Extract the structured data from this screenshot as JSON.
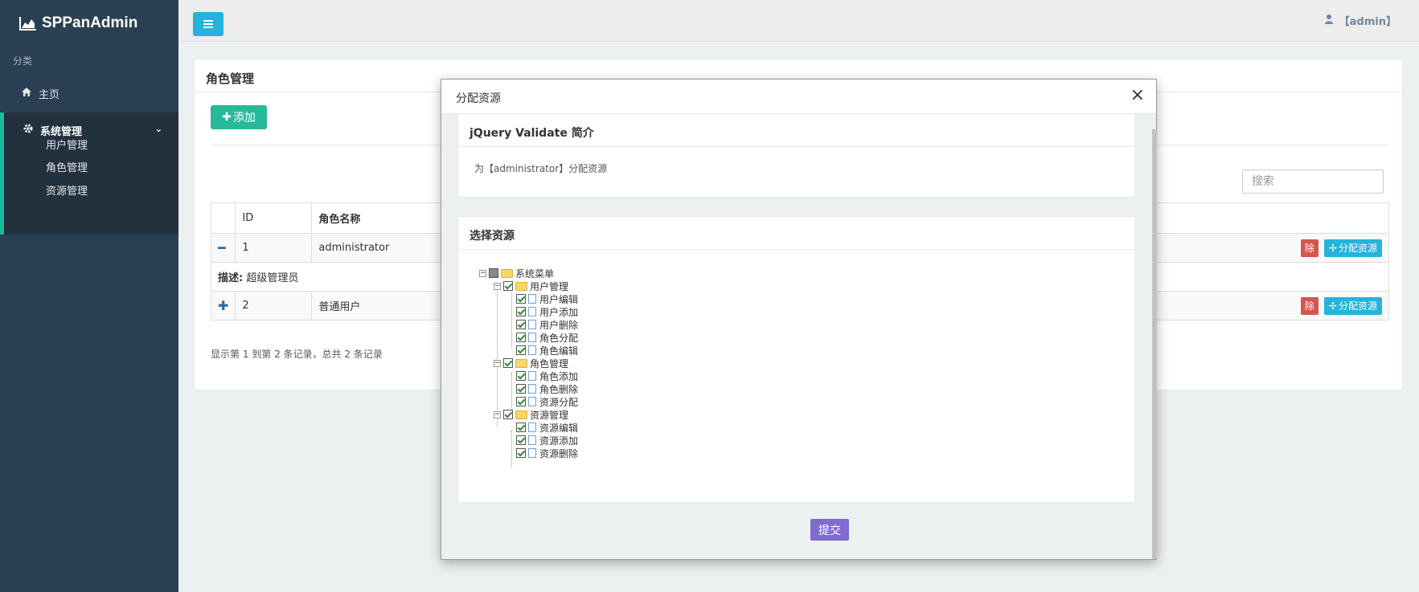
{
  "app": {
    "title": "SPPanAdmin"
  },
  "sidebar": {
    "section_label": "分类",
    "home_label": "主页",
    "group_label": "系统管理",
    "sub_items": [
      {
        "label": "用户管理"
      },
      {
        "label": "角色管理"
      },
      {
        "label": "资源管理"
      }
    ]
  },
  "topbar": {
    "user_label": "【admin】"
  },
  "panel": {
    "title": "角色管理",
    "add_label": "添加",
    "search_placeholder": "搜索",
    "columns": {
      "id": "ID",
      "name": "角色名称"
    },
    "rows": [
      {
        "id": "1",
        "name": "administrator",
        "detail_key": "描述:",
        "detail_value": "超级管理员",
        "delete_label": "除",
        "assign_label": "分配资源"
      },
      {
        "id": "2",
        "name": "普通用户",
        "delete_label": "除",
        "assign_label": "分配资源"
      }
    ],
    "footer": "显示第 1 到第 2 条记录，总共 2 条记录"
  },
  "modal": {
    "title": "分配资源",
    "close_label": "×",
    "intro": {
      "title": "jQuery Validate 简介",
      "text": "为【administrator】分配资源"
    },
    "resources": {
      "title": "选择资源",
      "root": "系统菜单",
      "groups": [
        {
          "label": "用户管理",
          "items": [
            "用户编辑",
            "用户添加",
            "用户删除",
            "角色分配",
            "角色编辑"
          ]
        },
        {
          "label": "角色管理",
          "items": [
            "角色添加",
            "角色删除",
            "资源分配"
          ]
        },
        {
          "label": "资源管理",
          "items": [
            "资源编辑",
            "资源添加",
            "资源删除"
          ]
        }
      ]
    },
    "submit_label": "提交"
  },
  "colors": {
    "sidebar": "#2a3f54",
    "accent": "#1abb9c",
    "primary": "#24b3dc",
    "success": "#26b99a",
    "danger": "#d9534f",
    "submit": "#7f6bd1"
  }
}
